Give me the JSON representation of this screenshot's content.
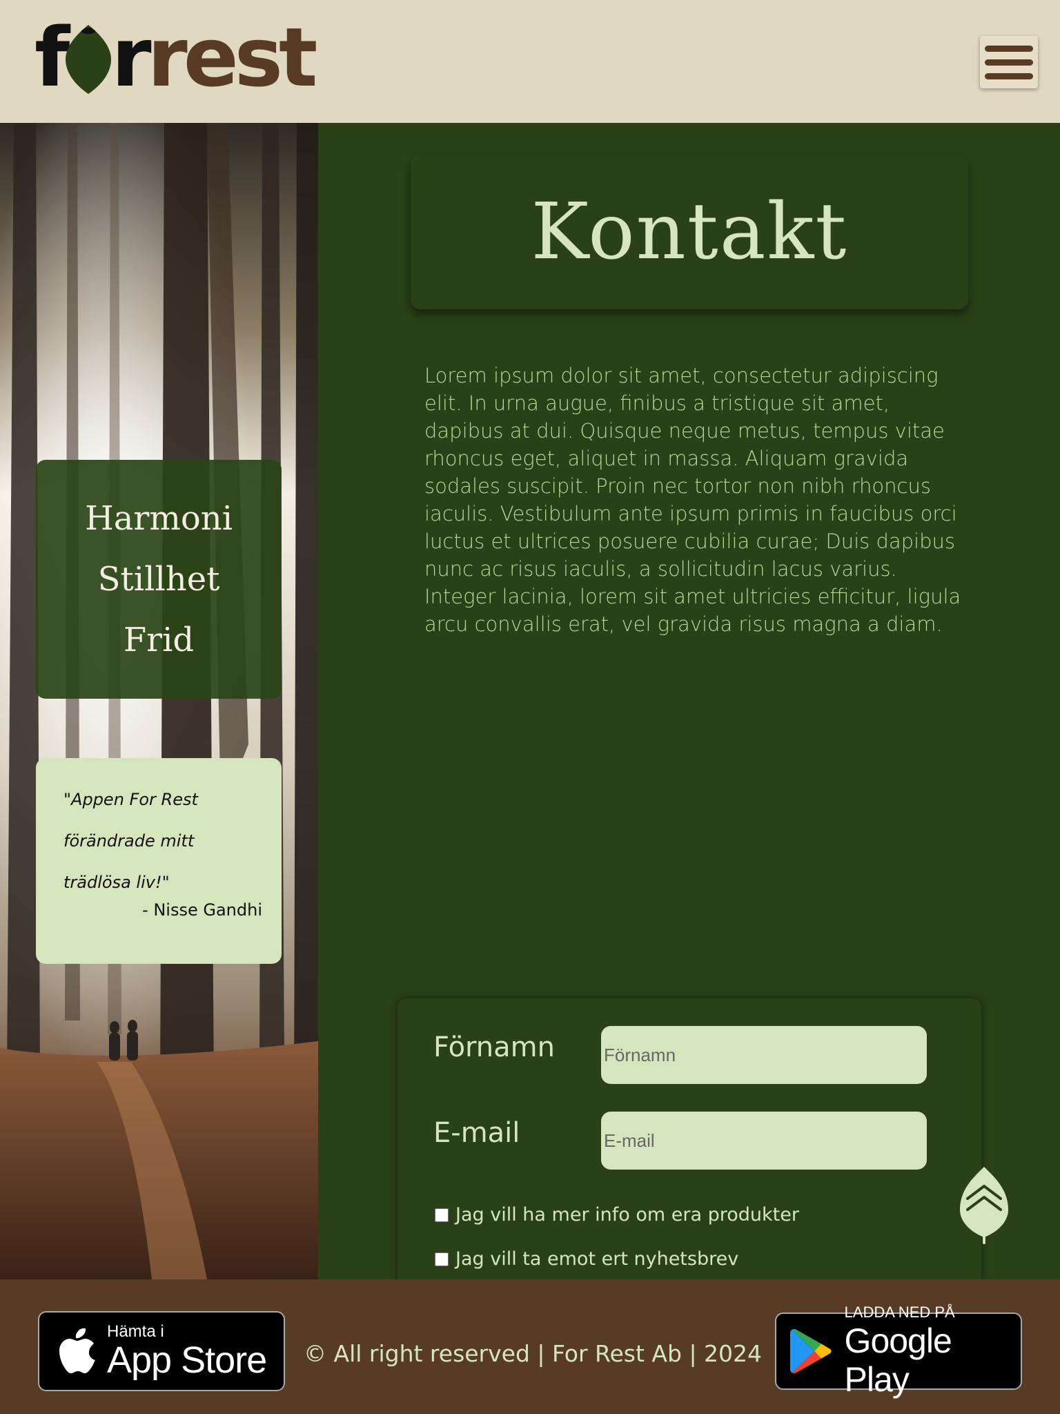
{
  "header": {
    "logo_text": "forrest",
    "menu_icon": "hamburger-menu-icon"
  },
  "sidebar": {
    "photo": "forest-path-photo",
    "harmony_words": [
      "Harmoni",
      "Stillhet",
      "Frid"
    ],
    "quote": {
      "text": "\"Appen For Rest förändrade mitt trädlösa liv!\"",
      "author": "- Nisse Gandhi"
    }
  },
  "main": {
    "title": "Kontakt",
    "body": "Lorem ipsum dolor sit amet, consectetur adipiscing elit. In urna augue, finibus a tristique sit amet, dapibus at dui. Quisque neque metus, tempus vitae rhoncus eget, aliquet in massa. Aliquam gravida sodales suscipit. Proin nec tortor non nibh rhoncus iaculis. Vestibulum ante ipsum primis in faucibus orci luctus et ultrices posuere cubilia curae; Duis dapibus nunc ac risus iaculis, a sollicitudin lacus varius. Integer lacinia, lorem sit amet ultricies efficitur, ligula arcu convallis erat, vel gravida risus magna a diam."
  },
  "form": {
    "firstname_label": "Förnamn",
    "firstname_placeholder": "Förnamn",
    "firstname_value": "",
    "email_label": "E-mail",
    "email_placeholder": "E-mail",
    "email_value": "",
    "checkbox_info_label": "Jag vill ha mer info om era produkter",
    "checkbox_info_checked": false,
    "checkbox_newsletter_label": "Jag vill ta emot ert nyhetsbrev",
    "checkbox_newsletter_checked": false
  },
  "scroll_top_icon": "leaf-chevron-up-icon",
  "footer": {
    "app_store": {
      "small": "Hämta i",
      "large": "App Store",
      "icon": "apple-icon"
    },
    "copyright": "© All right reserved | For Rest Ab | 2024",
    "google_play": {
      "small": "LADDA NED PÅ",
      "large": "Google Play",
      "icon": "google-play-icon"
    }
  },
  "colors": {
    "header_bg": "#e0d8c0",
    "brand_green": "#2a4017",
    "light_green": "#d6e6bc",
    "text_green": "#b8d79a",
    "brown": "#573b24"
  }
}
